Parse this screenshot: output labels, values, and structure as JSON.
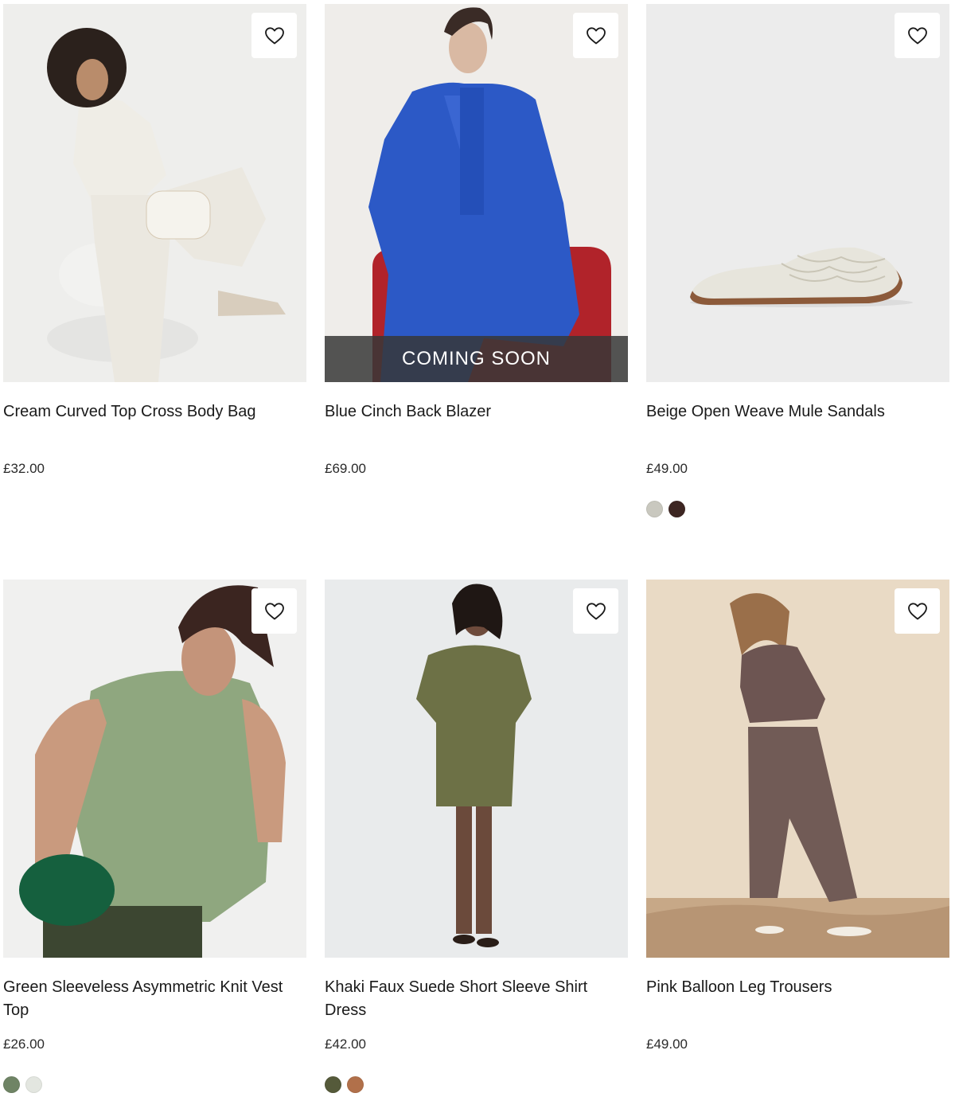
{
  "products": [
    {
      "name": "Cream Curved Top Cross Body Bag",
      "price": "£32.00",
      "badge": "",
      "wishlist_icon": "heart-outline-icon",
      "image_bg": "#eeeeec",
      "swatches": []
    },
    {
      "name": "Blue Cinch Back Blazer",
      "price": "£69.00",
      "badge": "COMING SOON",
      "wishlist_icon": "heart-outline-icon",
      "image_bg": "#efedea",
      "swatches": []
    },
    {
      "name": "Beige Open Weave Mule Sandals",
      "price": "£49.00",
      "badge": "",
      "wishlist_icon": "heart-outline-icon",
      "image_bg": "#ececec",
      "swatches": [
        "#c9c8bf",
        "#3d2622"
      ]
    },
    {
      "name": "Green Sleeveless Asymmetric Knit Vest Top",
      "price": "£26.00",
      "badge": "",
      "wishlist_icon": "heart-outline-icon",
      "image_bg": "#f0f0ef",
      "swatches": [
        "#6f8465",
        "#e3e6e0"
      ]
    },
    {
      "name": "Khaki Faux Suede Short Sleeve Shirt Dress",
      "price": "£42.00",
      "badge": "",
      "wishlist_icon": "heart-outline-icon",
      "image_bg": "#e9ebec",
      "swatches": [
        "#555a3a",
        "#b1704a"
      ]
    },
    {
      "name": "Pink Balloon Leg Trousers",
      "price": "£49.00",
      "badge": "",
      "wishlist_icon": "heart-outline-icon",
      "image_bg": "#e9dac5",
      "swatches": []
    }
  ]
}
